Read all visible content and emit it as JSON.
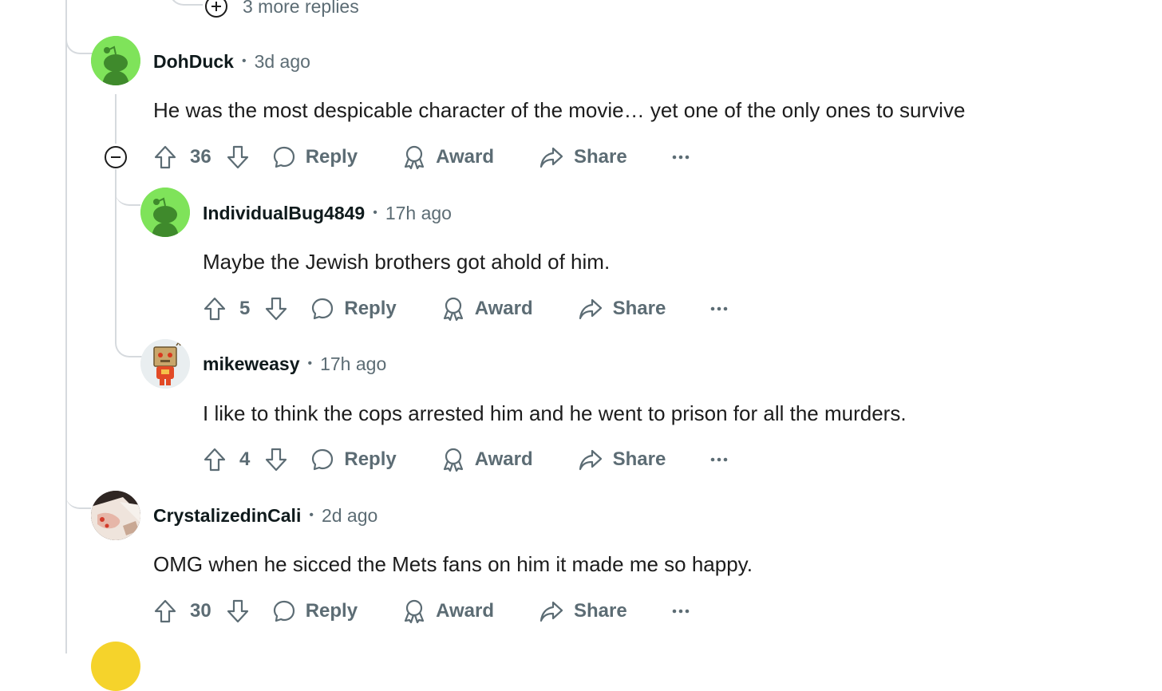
{
  "more_replies": {
    "label": "3 more replies"
  },
  "comments": [
    {
      "author": "DohDuck",
      "time": "3d ago",
      "text": "He was the most despicable character of the movie… yet one of the only ones to survive",
      "score": "36",
      "avatar": "snoo-green-avatar"
    },
    {
      "author": "IndividualBug4849",
      "time": "17h ago",
      "text": "Maybe the Jewish brothers got ahold of him.",
      "score": "5",
      "avatar": "snoo-green-avatar"
    },
    {
      "author": "mikeweasy",
      "time": "17h ago",
      "text": "I like to think the cops arrested him and he went to prison for all the murders.",
      "score": "4",
      "avatar": "robot-box-avatar"
    },
    {
      "author": "CrystalizedinCali",
      "time": "2d ago",
      "text": "OMG when he sicced the Mets fans on him it made me so happy.",
      "score": "30",
      "avatar": "photo-avatar"
    }
  ],
  "actions": {
    "reply": "Reply",
    "award": "Award",
    "share": "Share",
    "separator": "•"
  },
  "colors": {
    "meta_gray": "#5c6c74",
    "thread_line": "#d6dade",
    "snoo_green": "#7fe35a",
    "next_avatar_yellow": "#f5d32b"
  }
}
